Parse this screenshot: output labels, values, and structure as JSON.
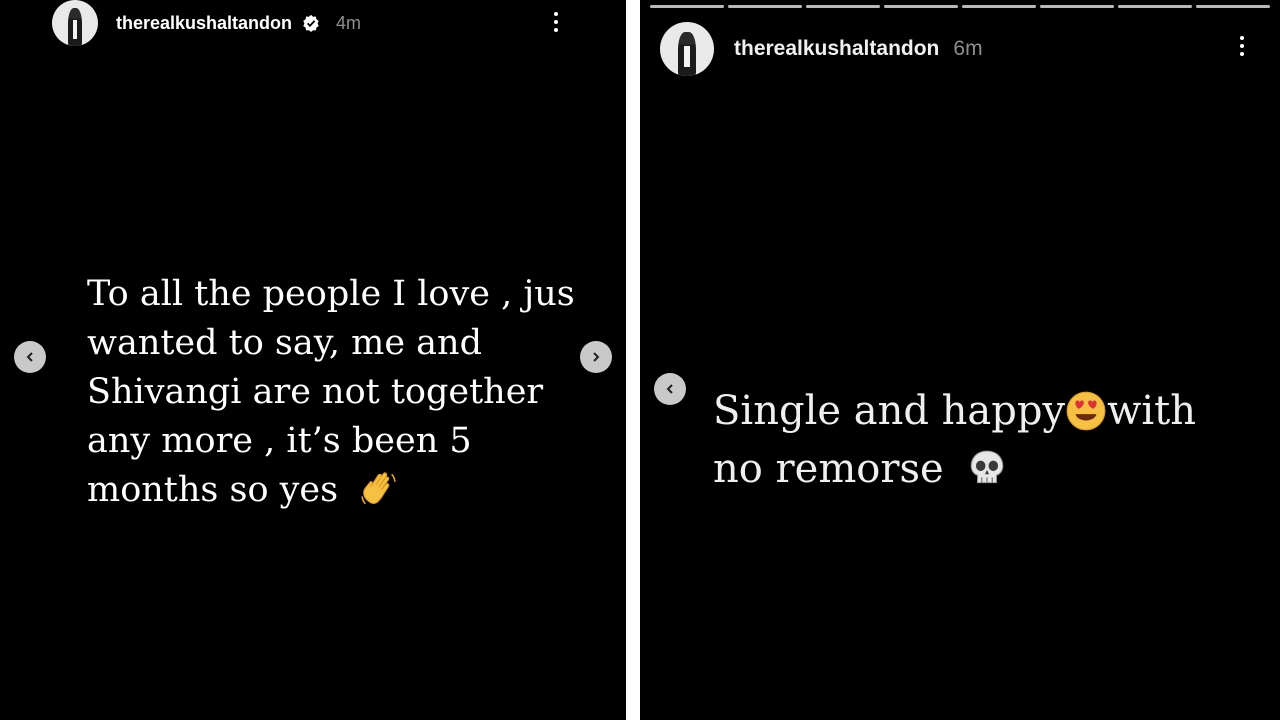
{
  "left_story": {
    "username": "therealkushaltandon",
    "time": "4m",
    "lines": [
      "To all the people I love , jus",
      "wanted to say, me and",
      "Shivangi are not together",
      "any more , it’s been 5",
      "months so yes"
    ],
    "emoji": "waving-hand-emoji"
  },
  "right_story": {
    "username": "therealkushaltandon",
    "time": "6m",
    "line1_before": "Single and happy",
    "line1_after": "with",
    "line2": "no remorse",
    "emoji1": "heart-eyes-emoji",
    "emoji2": "skull-emoji"
  },
  "colors": {
    "background": "#000000",
    "text": "#ffffff",
    "muted": "#8e8e8e",
    "divider": "#ffffff"
  }
}
